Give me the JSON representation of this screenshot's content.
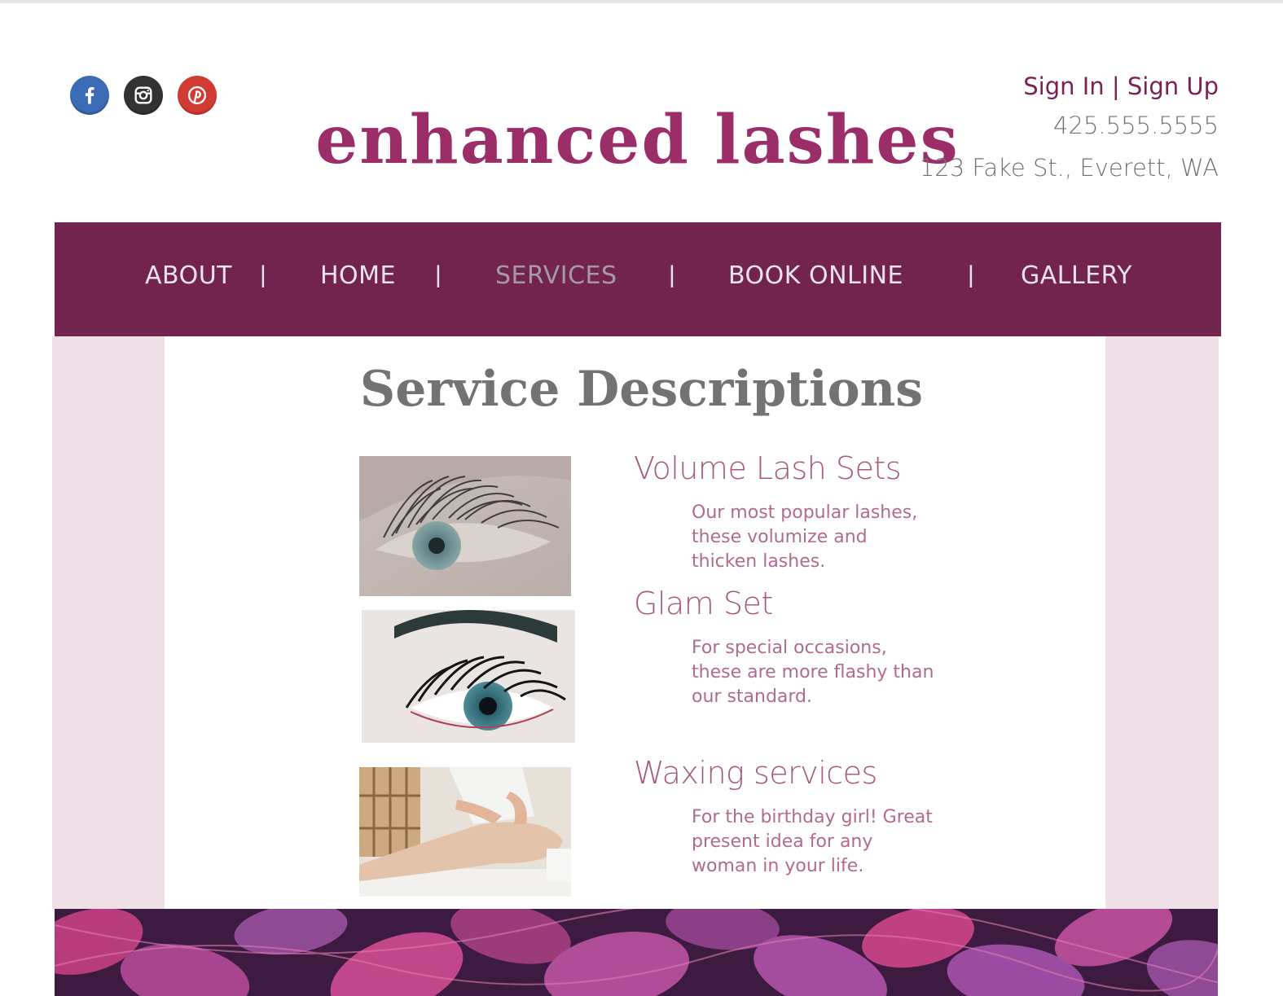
{
  "header": {
    "brand": "enhanced lashes",
    "sign_in": "Sign In",
    "auth_separator": " | ",
    "sign_up": "Sign Up",
    "phone": "425.555.5555",
    "address": "123 Fake St., Everett, WA"
  },
  "social": [
    {
      "icon": "facebook-icon",
      "color": "#3b6bb5"
    },
    {
      "icon": "instagram-icon",
      "color": "#333333"
    },
    {
      "icon": "pinterest-icon",
      "color": "#d23b34"
    }
  ],
  "nav": {
    "items": [
      "ABOUT",
      "HOME",
      "SERVICES",
      "BOOK ONLINE",
      "GALLERY"
    ],
    "separator": "|",
    "active": "SERVICES"
  },
  "main": {
    "title": "Service Descriptions",
    "services": [
      {
        "name": "Volume Lash Sets",
        "description": "Our most popular lashes, these volumize and thicken lashes."
      },
      {
        "name": "Glam Set",
        "description": "For special occasions, these are more flashy than our standard."
      },
      {
        "name": "Waxing services",
        "description": "For the birthday girl! Great present idea for any woman in your life."
      }
    ]
  },
  "colors": {
    "brand": "#9b2d68",
    "nav_bg": "#72244f",
    "side_panel": "#efe0e8",
    "service_title": "#a55b80"
  }
}
